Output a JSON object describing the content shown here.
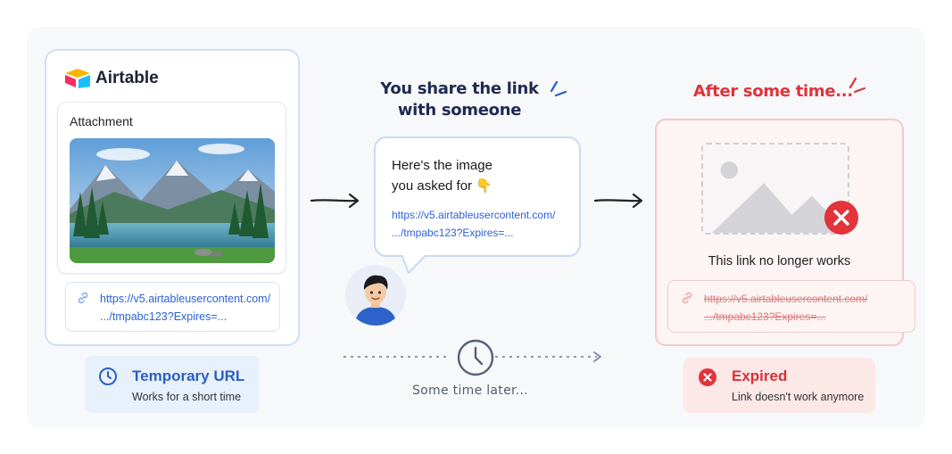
{
  "panel_source": {
    "brand": "Airtable",
    "attachment_label": "Attachment",
    "url_line1": "https://v5.airtableusercontent.com/",
    "url_line2": ".../tmpabc123?Expires=..."
  },
  "badge_temporary": {
    "title": "Temporary URL",
    "subtitle": "Works for a short time"
  },
  "share": {
    "caption_line1": "You share the link",
    "caption_line2": "with someone",
    "message_line1": "Here's the image",
    "message_line2": "you asked for 👇",
    "url_line1": "https://v5.airtableusercontent.com/",
    "url_line2": ".../tmpabc123?Expires=..."
  },
  "timeline": {
    "label": "Some time later..."
  },
  "expired_panel": {
    "caption": "After some time...",
    "message": "This link no longer works",
    "url_line1": "https://v5.airtableusercontent.com/",
    "url_line2": ".../tmpabc123?Expires=..."
  },
  "badge_expired": {
    "title": "Expired",
    "subtitle": "Link doesn't work anymore"
  },
  "colors": {
    "link_blue": "#2b62d9",
    "expired_red": "#e0323a",
    "temp_badge_bg": "#e8f0fc",
    "expired_badge_bg": "#fde8e8"
  }
}
